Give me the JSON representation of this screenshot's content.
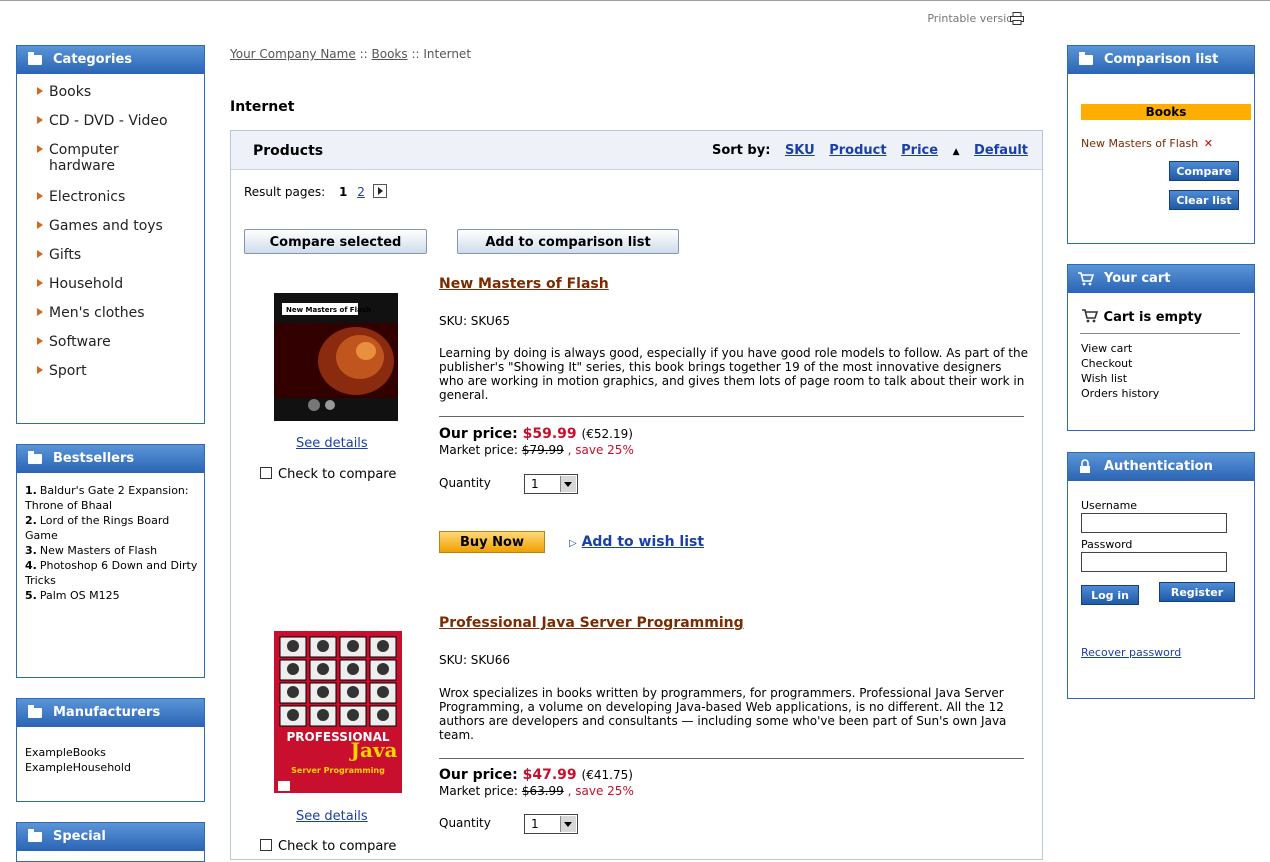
{
  "top": {
    "printable": "Printable version"
  },
  "breadcrumb": {
    "company": "Your Company Name",
    "sep": "::",
    "books": "Books",
    "current": "Internet"
  },
  "page_title": "Internet",
  "categories": {
    "title": "Categories",
    "items": [
      "Books",
      "CD - DVD - Video",
      "Computer hardware",
      "Electronics",
      "Games and toys",
      "Gifts",
      "Household",
      "Men's clothes",
      "Software",
      "Sport"
    ]
  },
  "bestsellers": {
    "title": "Bestsellers",
    "items": [
      {
        "num": "1.",
        "text": "Baldur's Gate 2 Expansion: Throne of Bhaal"
      },
      {
        "num": "2.",
        "text": "Lord of the Rings Board Game"
      },
      {
        "num": "3.",
        "text": "New Masters of Flash"
      },
      {
        "num": "4.",
        "text": "Photoshop 6 Down and Dirty Tricks"
      },
      {
        "num": "5.",
        "text": "Palm OS M125"
      }
    ]
  },
  "manufacturers": {
    "title": "Manufacturers",
    "items": [
      "ExampleBooks",
      "ExampleHousehold"
    ]
  },
  "special": {
    "title": "Special"
  },
  "products": {
    "header": "Products",
    "sort_label": "Sort by:",
    "sort_options": [
      "SKU",
      "Product",
      "Price",
      "Default"
    ],
    "result_pages_label": "Result pages:",
    "page_current": "1",
    "page_next": "2",
    "compare_selected": "Compare selected",
    "add_to_comparison": "Add to comparison list",
    "see_details": "See details",
    "check_to_compare": "Check to compare",
    "our_price_label": "Our price:",
    "market_price_label": "Market price:",
    "quantity_label": "Quantity",
    "buy_now": "Buy Now",
    "add_to_wishlist": "Add to wish list",
    "items": [
      {
        "title": "New Masters of Flash",
        "sku": "SKU: SKU65",
        "description": "Learning by doing is always good, especially if you have good role models to follow. As part of the publisher's \"Showing It\" series, this book brings together 19 of the most innovative designers who are working in motion graphics, and gives them lots of page room to talk about their work in general.",
        "price": "$59.99",
        "price_alt": "(€52.19)",
        "market": "$79.99",
        "save": ", save 25%",
        "qty": "1",
        "cover_title": "New Masters of Flash"
      },
      {
        "title": "Professional Java Server Programming",
        "sku": "SKU: SKU66",
        "description": "Wrox specializes in books written by programmers, for programmers. Professional Java Server Programming, a volume on developing Java-based Web applications, is no different. All the 12 authors are developers and consultants — including some who've been part of Sun's own Java team.",
        "price": "$47.99",
        "price_alt": "(€41.75)",
        "market": "$63.99",
        "save": ", save 25%",
        "qty": "1",
        "cover_title": "PROFESSIONAL",
        "cover_big": "Java",
        "cover_sub": "Server Programming"
      }
    ]
  },
  "comparison": {
    "title": "Comparison list",
    "group": "Books",
    "item": "New Masters of Flash",
    "remove": "✕",
    "compare": "Compare",
    "clear": "Clear list"
  },
  "cart": {
    "title": "Your cart",
    "status": "Cart is empty",
    "links": [
      "View cart",
      "Checkout",
      "Wish list",
      "Orders history"
    ]
  },
  "auth": {
    "title": "Authentication",
    "username_label": "Username",
    "password_label": "Password",
    "login": "Log in",
    "register": "Register",
    "recover": "Recover password"
  }
}
